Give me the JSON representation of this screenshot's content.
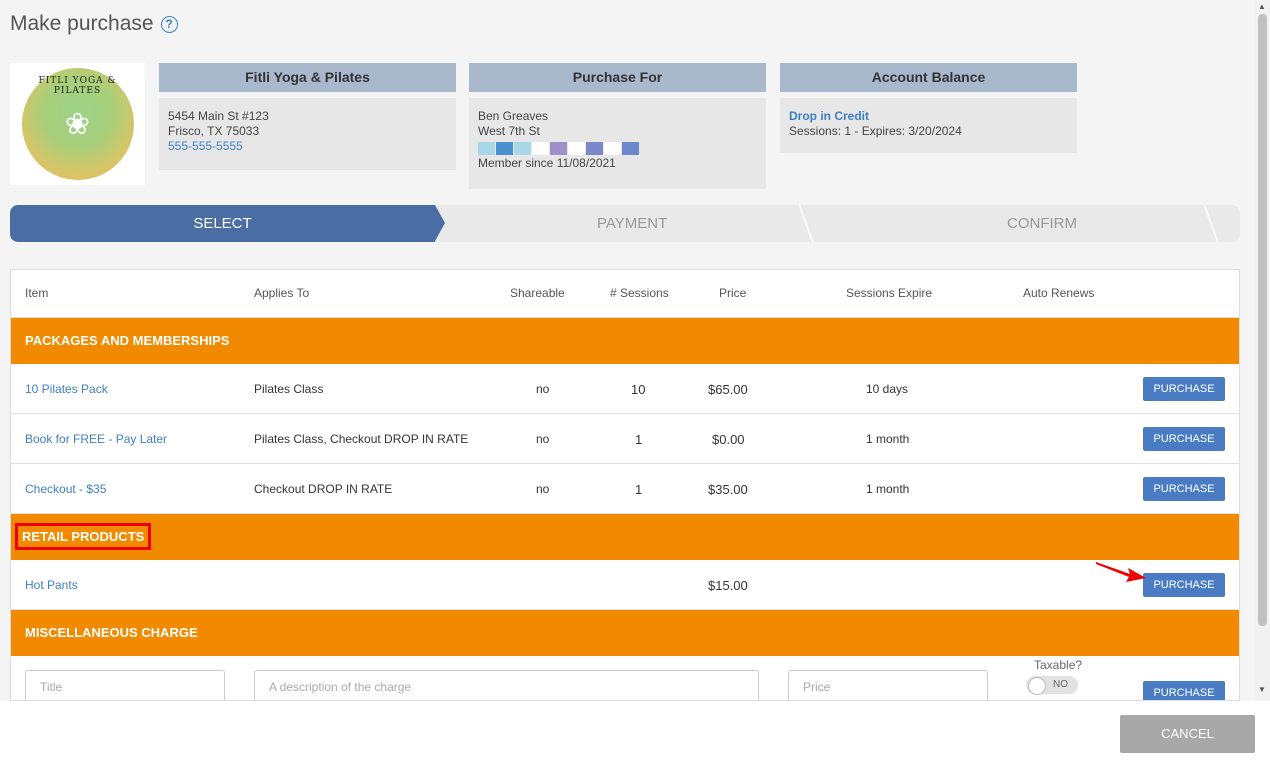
{
  "title": "Make purchase",
  "studio": {
    "header": "Fitli Yoga & Pilates",
    "address1": "5454 Main St #123",
    "address2": "Frisco, TX 75033",
    "phone": "555-555-5555",
    "logo_text": "FITLI YOGA & PILATES"
  },
  "purchase_for": {
    "header": "Purchase For",
    "name": "Ben Greaves",
    "location": "West 7th St",
    "member_since": "Member since 11/08/2021",
    "swatch_colors": [
      "#a8d8e8",
      "#4a90d0",
      "#a8d8e8",
      "#ffffff",
      "#a090c8",
      "#ffffff",
      "#7c88c8",
      "#ffffff",
      "#6c88cc"
    ]
  },
  "account_balance": {
    "header": "Account Balance",
    "credit_label": "Drop in Credit",
    "credit_detail": "Sessions: 1 - Expires: 3/20/2024"
  },
  "steps": [
    "SELECT",
    "PAYMENT",
    "CONFIRM"
  ],
  "columns": {
    "item": "Item",
    "applies_to": "Applies To",
    "shareable": "Shareable",
    "sessions": "# Sessions",
    "price": "Price",
    "expire": "Sessions Expire",
    "auto_renews": "Auto Renews"
  },
  "packages": {
    "header": "PACKAGES AND MEMBERSHIPS",
    "rows": [
      {
        "item": "10 Pilates Pack",
        "applies_to": "Pilates Class",
        "shareable": "no",
        "sessions": "10",
        "price": "$65.00",
        "expire": "10 days"
      },
      {
        "item": "Book for FREE - Pay Later",
        "applies_to": "Pilates Class, Checkout DROP IN RATE",
        "shareable": "no",
        "sessions": "1",
        "price": "$0.00",
        "expire": "1 month"
      },
      {
        "item": "Checkout - $35",
        "applies_to": "Checkout DROP IN RATE",
        "shareable": "no",
        "sessions": "1",
        "price": "$35.00",
        "expire": "1 month"
      }
    ]
  },
  "retail": {
    "header": "RETAIL PRODUCTS",
    "rows": [
      {
        "item": "Hot Pants",
        "price": "$15.00"
      }
    ]
  },
  "misc": {
    "header": "MISCELLANEOUS CHARGE",
    "title_placeholder": "Title",
    "description_placeholder": "A description of the charge",
    "price_placeholder": "Price",
    "taxable_label": "Taxable?",
    "taxable_value": "NO"
  },
  "purchase_label": "PURCHASE",
  "cancel_label": "CANCEL",
  "colors": {
    "accent_blue": "#4a6ea4",
    "category_orange": "#f28a00",
    "button_blue": "#4a7cc4",
    "highlight_red": "#e00000"
  }
}
